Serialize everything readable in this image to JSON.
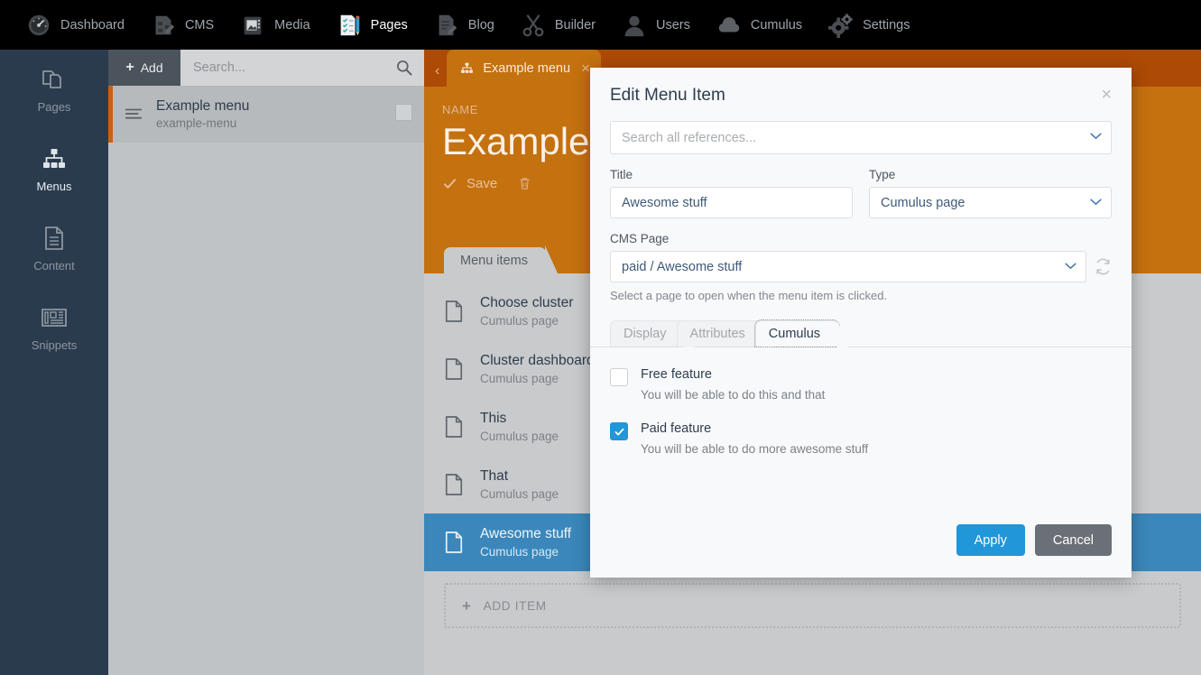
{
  "topnav": {
    "items": [
      {
        "label": "Dashboard",
        "icon": "gauge-icon",
        "active": false
      },
      {
        "label": "CMS",
        "icon": "cms-icon",
        "active": false
      },
      {
        "label": "Media",
        "icon": "media-icon",
        "active": false
      },
      {
        "label": "Pages",
        "icon": "pages-icon",
        "active": true
      },
      {
        "label": "Blog",
        "icon": "blog-icon",
        "active": false
      },
      {
        "label": "Builder",
        "icon": "scissors-icon",
        "active": false
      },
      {
        "label": "Users",
        "icon": "user-icon",
        "active": false
      },
      {
        "label": "Cumulus",
        "icon": "cloud-icon",
        "active": false
      },
      {
        "label": "Settings",
        "icon": "gear-icon",
        "active": false
      }
    ]
  },
  "sidebar": {
    "items": [
      {
        "label": "Pages",
        "icon": "copies-icon",
        "active": false
      },
      {
        "label": "Menus",
        "icon": "sitemap-icon",
        "active": true
      },
      {
        "label": "Content",
        "icon": "document-icon",
        "active": false
      },
      {
        "label": "Snippets",
        "icon": "newspaper-icon",
        "active": false
      }
    ]
  },
  "list_panel": {
    "add_label": "Add",
    "search_placeholder": "Search...",
    "search_value": "",
    "rows": [
      {
        "title": "Example menu",
        "subtitle": "example-menu",
        "selected": true
      }
    ]
  },
  "main": {
    "doc_tab": {
      "label": "Example menu",
      "close": "×"
    },
    "name_label": "NAME",
    "name_value": "Example menu",
    "save_label": "Save",
    "subtabs": [
      {
        "label": "Menu items",
        "active": true
      }
    ],
    "menu_items": [
      {
        "title": "Choose cluster",
        "subtitle": "Cumulus page",
        "selected": false
      },
      {
        "title": "Cluster dashboard",
        "subtitle": "Cumulus page",
        "selected": false
      },
      {
        "title": "This",
        "subtitle": "Cumulus page",
        "selected": false
      },
      {
        "title": "That",
        "subtitle": "Cumulus page",
        "selected": false
      },
      {
        "title": "Awesome stuff",
        "subtitle": "Cumulus page",
        "selected": true
      }
    ],
    "add_item_label": "ADD ITEM"
  },
  "modal": {
    "title": "Edit Menu Item",
    "close": "×",
    "reference_search_placeholder": "Search all references...",
    "reference_search_value": "",
    "title_field": {
      "label": "Title",
      "value": "Awesome stuff"
    },
    "type_field": {
      "label": "Type",
      "value": "Cumulus page"
    },
    "cms_page_field": {
      "label": "CMS Page",
      "value": "paid / Awesome stuff",
      "hint": "Select a page to open when the menu item is clicked."
    },
    "tabs": [
      {
        "label": "Display",
        "active": false
      },
      {
        "label": "Attributes",
        "active": false
      },
      {
        "label": "Cumulus",
        "active": true
      }
    ],
    "checkboxes": [
      {
        "label": "Free feature",
        "description": "You will be able to do this and that",
        "checked": false
      },
      {
        "label": "Paid feature",
        "description": "You will be able to do more awesome stuff",
        "checked": true
      }
    ],
    "apply_label": "Apply",
    "cancel_label": "Cancel"
  },
  "colors": {
    "accent_blue": "#2196d9",
    "brand_orange": "#c4710f",
    "tabstrip_orange": "#ad4a05",
    "sidebar_dark": "#2b3b4e",
    "selection_blue": "#3b87bb",
    "cancel_gray": "#6b7078"
  }
}
